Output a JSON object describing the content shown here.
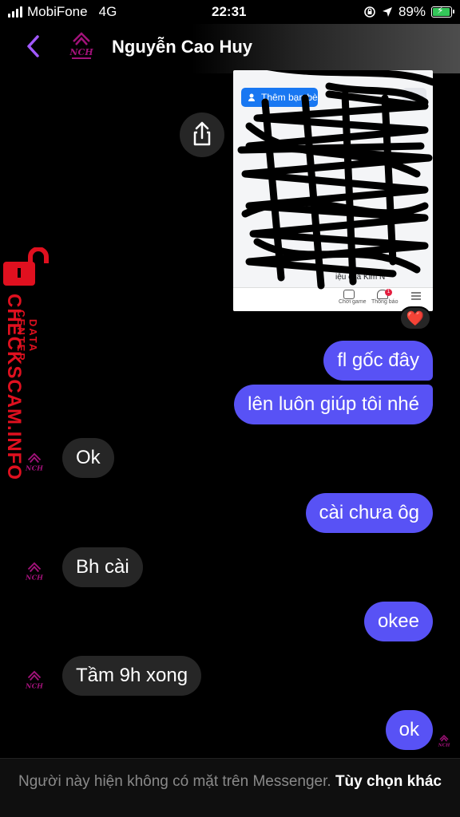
{
  "status_bar": {
    "carrier": "MobiFone",
    "network": "4G",
    "time": "22:31",
    "battery": "89%",
    "battery_level": 0.89
  },
  "header": {
    "contact_name": "Nguyễn Cao Huy",
    "avatar_text": "NCH"
  },
  "shared_image": {
    "add_friend_label": "Thêm bạn bè",
    "more_label": "···",
    "caption_fragment": "iệu của Kim N",
    "tab_game": "Chơi game",
    "tab_notifications": "Thông báo",
    "notification_count": "1"
  },
  "reaction": "❤️",
  "messages": [
    {
      "direction": "out",
      "text": "fl gốc đây"
    },
    {
      "direction": "out",
      "text": "lên luôn giúp tôi nhé"
    },
    {
      "direction": "in",
      "text": "Ok"
    },
    {
      "direction": "out",
      "text": "cài chưa ôg"
    },
    {
      "direction": "in",
      "text": "Bh cài"
    },
    {
      "direction": "out",
      "text": "okee"
    },
    {
      "direction": "in",
      "text": "Tầm 9h xong"
    },
    {
      "direction": "out",
      "text": "ok"
    }
  ],
  "watermark": {
    "main": "CHECKSCAM.INFO",
    "sub": "DATA CENTER"
  },
  "footer": {
    "notice": "Người này hiện không có mặt trên Messenger.",
    "link": "Tùy chọn khác"
  },
  "colors": {
    "accent": "#a259ff",
    "outgoing_bubble": "#5852f5",
    "incoming_bubble": "#262626",
    "watermark": "#e0101f"
  }
}
